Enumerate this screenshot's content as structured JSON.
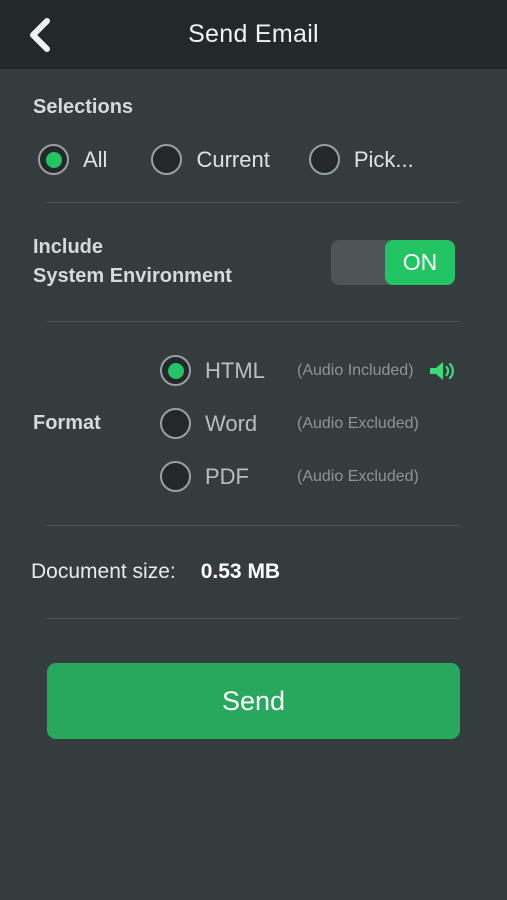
{
  "header": {
    "title": "Send Email",
    "back_icon": "chevron-left-icon"
  },
  "selections": {
    "title": "Selections",
    "options": [
      {
        "label": "All",
        "selected": true
      },
      {
        "label": "Current",
        "selected": false
      },
      {
        "label": "Pick...",
        "selected": false
      }
    ]
  },
  "include_system_environment": {
    "label_line1": "Include",
    "label_line2": "System Environment",
    "toggle_state": "ON"
  },
  "format": {
    "title": "Format",
    "options": [
      {
        "name": "HTML",
        "note": "(Audio Included)",
        "selected": true,
        "icon": "speaker-icon"
      },
      {
        "name": "Word",
        "note": "(Audio Excluded)",
        "selected": false
      },
      {
        "name": "PDF",
        "note": "(Audio Excluded)",
        "selected": false
      }
    ]
  },
  "document_size": {
    "label": "Document size:",
    "value": "0.53 MB"
  },
  "actions": {
    "send_label": "Send"
  },
  "colors": {
    "background": "#343c3e",
    "header_background": "#23282b",
    "accent_green": "#22c463",
    "button_green": "#28a85c",
    "divider": "#4e5557"
  }
}
